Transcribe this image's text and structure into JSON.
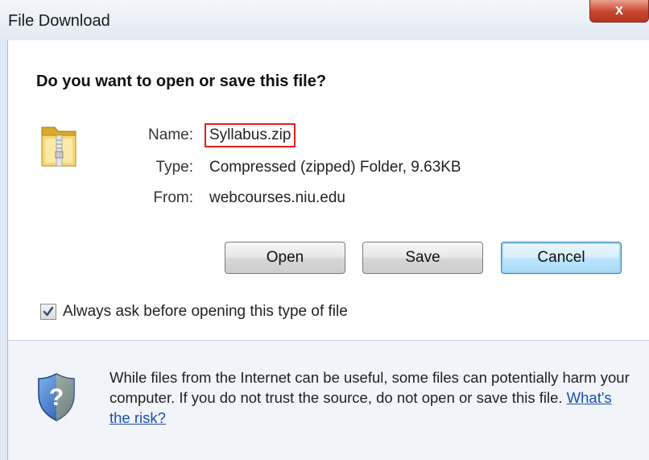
{
  "window": {
    "title": "File Download",
    "close_label": "x"
  },
  "dialog": {
    "question": "Do you want to open or save this file?",
    "icon": "zip-folder-icon",
    "info": {
      "name_label": "Name:",
      "name_value": "Syllabus.zip",
      "type_label": "Type:",
      "type_value": "Compressed (zipped) Folder, 9.63KB",
      "from_label": "From:",
      "from_value": "webcourses.niu.edu"
    },
    "buttons": {
      "open": "Open",
      "save": "Save",
      "cancel": "Cancel"
    },
    "checkbox": {
      "label": "Always ask before opening this type of file",
      "checked": true
    },
    "warning": {
      "icon": "security-shield-icon",
      "text": "While files from the Internet can be useful, some files can potentially harm your computer. If you do not trust the source, do not open or save this file.",
      "link": "What's the risk?"
    }
  },
  "colors": {
    "highlight_border": "#e02020",
    "link": "#1a4fb5",
    "close_button": "#c7452d"
  }
}
